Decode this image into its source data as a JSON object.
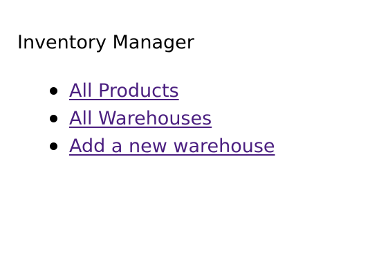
{
  "header": {
    "title": "Inventory Manager"
  },
  "nav": {
    "items": [
      {
        "label": "All Products"
      },
      {
        "label": "All Warehouses"
      },
      {
        "label": "Add a new warehouse"
      }
    ]
  },
  "colors": {
    "link": "#4b1f80",
    "text": "#000000",
    "background": "#ffffff"
  }
}
